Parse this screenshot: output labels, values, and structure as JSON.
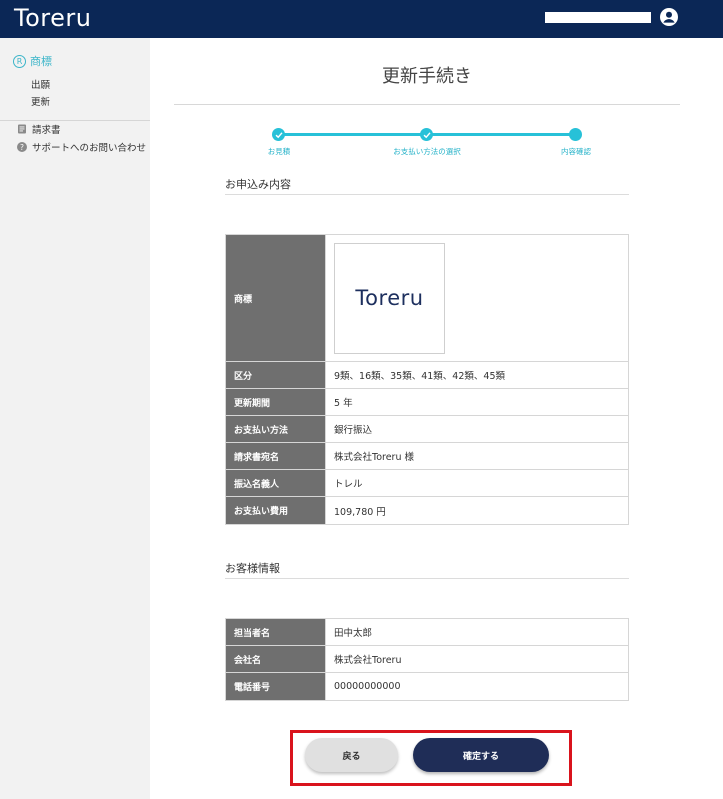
{
  "header": {
    "logo_text": "Toreru",
    "user_icon": "account-circle-icon"
  },
  "sidebar": {
    "main_item": {
      "label": "商標",
      "icon": "trademark-icon"
    },
    "sub_items": [
      {
        "label": "出願"
      },
      {
        "label": "更新"
      }
    ],
    "links": [
      {
        "label": "請求書",
        "icon": "invoice-icon"
      },
      {
        "label": "サポートへのお問い合わせ",
        "icon": "help-icon"
      }
    ]
  },
  "page": {
    "title": "更新手続き"
  },
  "stepper": {
    "steps": [
      {
        "label": "お見積",
        "state": "done"
      },
      {
        "label": "お支払い方法の選択",
        "state": "done"
      },
      {
        "label": "内容確認",
        "state": "current"
      }
    ],
    "color": "#27c1d8"
  },
  "application": {
    "section_title": "お申込み内容",
    "trademark_label": "商標",
    "trademark_logo_text": "Toreru",
    "rows": [
      {
        "label": "区分",
        "value": "9類、16類、35類、41類、42類、45類"
      },
      {
        "label": "更新期間",
        "value": "5 年"
      },
      {
        "label": "お支払い方法",
        "value": "銀行振込"
      },
      {
        "label": "請求書宛名",
        "value": "株式会社Toreru 様"
      },
      {
        "label": "振込名義人",
        "value": "トレル"
      },
      {
        "label": "お支払い費用",
        "value": "109,780 円"
      }
    ]
  },
  "customer": {
    "section_title": "お客様情報",
    "rows": [
      {
        "label": "担当者名",
        "value": "田中太郎"
      },
      {
        "label": "会社名",
        "value": "株式会社Toreru"
      },
      {
        "label": "電話番号",
        "value": "00000000000"
      }
    ]
  },
  "actions": {
    "back_label": "戻る",
    "confirm_label": "確定する",
    "highlight_color": "#d9131c"
  }
}
